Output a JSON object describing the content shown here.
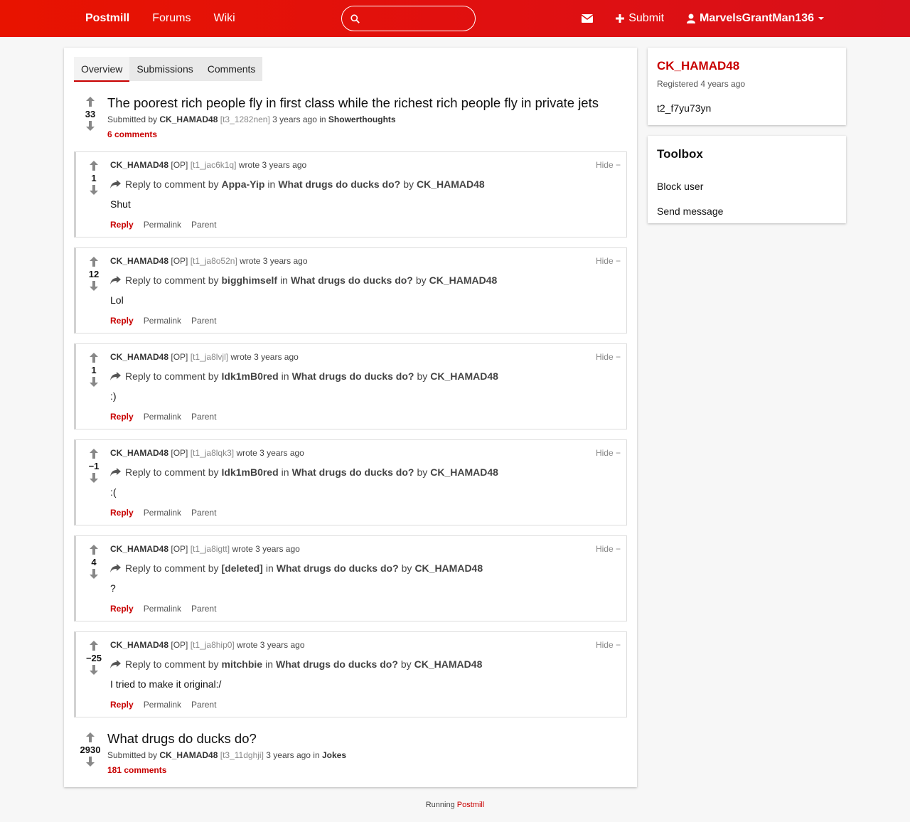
{
  "nav": {
    "brand": "Postmill",
    "forums": "Forums",
    "wiki": "Wiki",
    "search_value": "",
    "submit": "Submit",
    "username": "MarvelsGrantMan136"
  },
  "tabs": [
    "Overview",
    "Submissions",
    "Comments"
  ],
  "submissions": [
    {
      "score": "33",
      "title": "The poorest rich people fly in first class while the richest rich people fly in private jets",
      "submitted_by": "Submitted by",
      "author": "CK_HAMAD48",
      "id": "[t3_1282nen]",
      "when": "3 years ago in",
      "forum": "Showerthoughts",
      "comments": "6 comments"
    },
    {
      "score": "2930",
      "title": "What drugs do ducks do?",
      "submitted_by": "Submitted by",
      "author": "CK_HAMAD48",
      "id": "[t3_11dghji]",
      "when": "3 years ago in",
      "forum": "Jokes",
      "comments": "181 comments"
    }
  ],
  "comment_labels": {
    "op": "[OP]",
    "wrote": "wrote 3 years ago",
    "hide": "Hide −",
    "reply_to": "Reply to comment by",
    "in": "in",
    "by": "by",
    "post_title": "What drugs do ducks do?",
    "post_author": "CK_HAMAD48",
    "reply": "Reply",
    "permalink": "Permalink",
    "parent": "Parent"
  },
  "comments": [
    {
      "score": "1",
      "author": "CK_HAMAD48",
      "id": "[t1_jac6k1q]",
      "parent_author": "Appa-Yip",
      "body": "Shut"
    },
    {
      "score": "12",
      "author": "CK_HAMAD48",
      "id": "[t1_ja8o52n]",
      "parent_author": "bigghimself",
      "body": "Lol"
    },
    {
      "score": "1",
      "author": "CK_HAMAD48",
      "id": "[t1_ja8lvjl]",
      "parent_author": "Idk1mB0red",
      "body": ":)"
    },
    {
      "score": "−1",
      "author": "CK_HAMAD48",
      "id": "[t1_ja8lqk3]",
      "parent_author": "Idk1mB0red",
      "body": ":("
    },
    {
      "score": "4",
      "author": "CK_HAMAD48",
      "id": "[t1_ja8igtt]",
      "parent_author": "[deleted]",
      "body": "?"
    },
    {
      "score": "−25",
      "author": "CK_HAMAD48",
      "id": "[t1_ja8hip0]",
      "parent_author": "mitchbie",
      "body": "I tried to make it original:/"
    }
  ],
  "profile": {
    "username": "CK_HAMAD48",
    "registered": "Registered 4 years ago",
    "user_id": "t2_f7yu73yn"
  },
  "toolbox": {
    "title": "Toolbox",
    "block": "Block user",
    "message": "Send message"
  },
  "footer": {
    "running": "Running",
    "link": "Postmill"
  },
  "colors": {
    "brand": "#e01010",
    "accent": "#c80000"
  }
}
